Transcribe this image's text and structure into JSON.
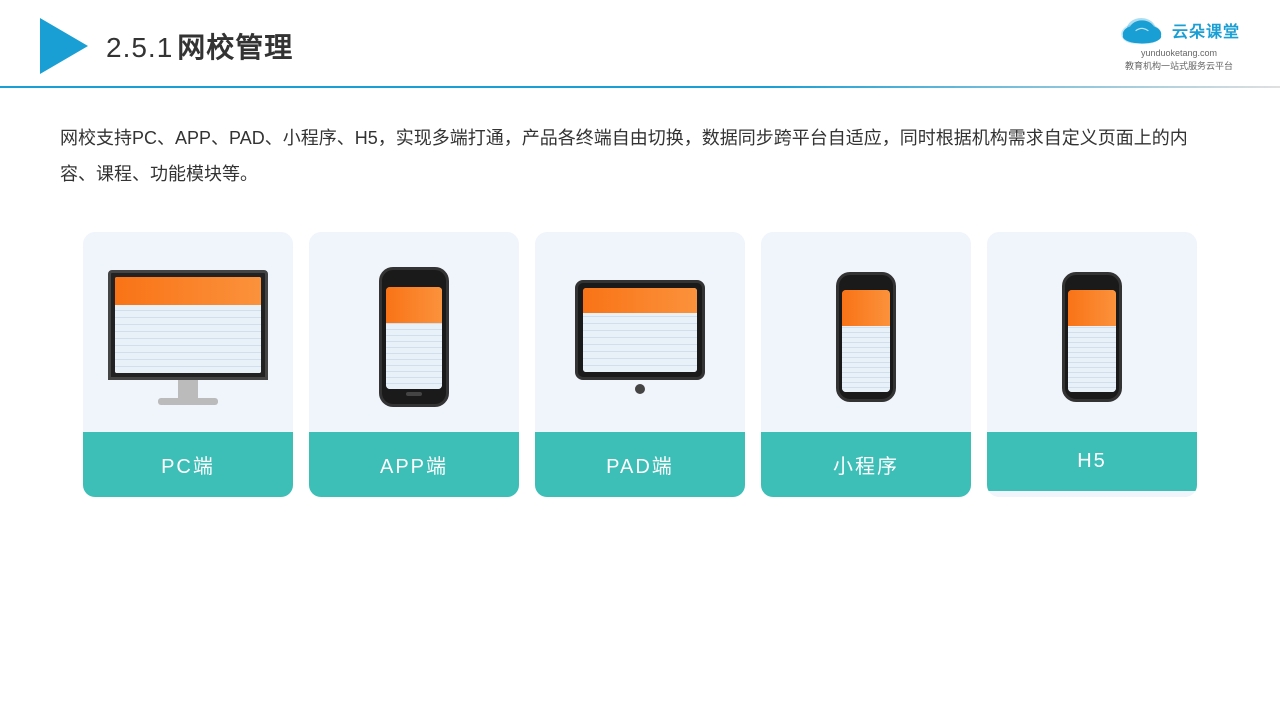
{
  "header": {
    "logo_triangle_color": "#1a9fd4",
    "title_prefix": "2.5.1",
    "title_main": "网校管理",
    "brand_name": "云朵课堂",
    "brand_url": "yunduoketang.com",
    "brand_tagline_line1": "教育机构一站",
    "brand_tagline_line2": "式服务云平台"
  },
  "description": {
    "text": "网校支持PC、APP、PAD、小程序、H5，实现多端打通，产品各终端自由切换，数据同步跨平台自适应，同时根据机构需求自定义页面上的内容、课程、功能模块等。"
  },
  "cards": [
    {
      "id": "pc",
      "label": "PC端"
    },
    {
      "id": "app",
      "label": "APP端"
    },
    {
      "id": "pad",
      "label": "PAD端"
    },
    {
      "id": "miniapp",
      "label": "小程序"
    },
    {
      "id": "h5",
      "label": "H5"
    }
  ]
}
